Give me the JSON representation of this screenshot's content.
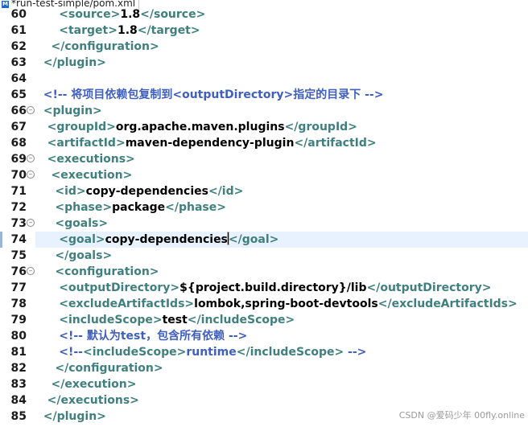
{
  "tab": {
    "title": "*run-test-simple/pom.xml",
    "icon": "xml-file-icon"
  },
  "lines": [
    {
      "num": "60",
      "fold": false,
      "segments": [
        {
          "t": "      ",
          "c": "tx"
        },
        {
          "t": "<source>",
          "c": "tg"
        },
        {
          "t": "1.8",
          "c": "tx"
        },
        {
          "t": "</source>",
          "c": "tg"
        }
      ]
    },
    {
      "num": "61",
      "fold": false,
      "segments": [
        {
          "t": "      ",
          "c": "tx"
        },
        {
          "t": "<target>",
          "c": "tg"
        },
        {
          "t": "1.8",
          "c": "tx"
        },
        {
          "t": "</target>",
          "c": "tg"
        }
      ]
    },
    {
      "num": "62",
      "fold": false,
      "segments": [
        {
          "t": "    ",
          "c": "tx"
        },
        {
          "t": "</configuration>",
          "c": "tg"
        }
      ]
    },
    {
      "num": "63",
      "fold": false,
      "segments": [
        {
          "t": "  ",
          "c": "tx"
        },
        {
          "t": "</plugin>",
          "c": "tg"
        }
      ]
    },
    {
      "num": "64",
      "fold": false,
      "segments": []
    },
    {
      "num": "65",
      "fold": false,
      "segments": [
        {
          "t": "  ",
          "c": "tx"
        },
        {
          "t": "<!-- 将项目依赖包复制到<outputDirectory>指定的目录下 -->",
          "c": "cm"
        }
      ]
    },
    {
      "num": "66",
      "fold": true,
      "segments": [
        {
          "t": "  ",
          "c": "tx"
        },
        {
          "t": "<plugin>",
          "c": "tg"
        }
      ]
    },
    {
      "num": "67",
      "fold": false,
      "segments": [
        {
          "t": "   ",
          "c": "tx"
        },
        {
          "t": "<groupId>",
          "c": "tg"
        },
        {
          "t": "org.apache.maven.plugins",
          "c": "tx"
        },
        {
          "t": "</groupId>",
          "c": "tg"
        }
      ]
    },
    {
      "num": "68",
      "fold": false,
      "segments": [
        {
          "t": "   ",
          "c": "tx"
        },
        {
          "t": "<artifactId>",
          "c": "tg"
        },
        {
          "t": "maven-dependency-plugin",
          "c": "tx"
        },
        {
          "t": "</artifactId>",
          "c": "tg"
        }
      ]
    },
    {
      "num": "69",
      "fold": true,
      "segments": [
        {
          "t": "   ",
          "c": "tx"
        },
        {
          "t": "<executions>",
          "c": "tg"
        }
      ]
    },
    {
      "num": "70",
      "fold": true,
      "segments": [
        {
          "t": "    ",
          "c": "tx"
        },
        {
          "t": "<execution>",
          "c": "tg"
        }
      ]
    },
    {
      "num": "71",
      "fold": false,
      "segments": [
        {
          "t": "     ",
          "c": "tx"
        },
        {
          "t": "<id>",
          "c": "tg"
        },
        {
          "t": "copy-dependencies",
          "c": "tx"
        },
        {
          "t": "</id>",
          "c": "tg"
        }
      ]
    },
    {
      "num": "72",
      "fold": false,
      "segments": [
        {
          "t": "     ",
          "c": "tx"
        },
        {
          "t": "<phase>",
          "c": "tg"
        },
        {
          "t": "package",
          "c": "tx"
        },
        {
          "t": "</phase>",
          "c": "tg"
        }
      ]
    },
    {
      "num": "73",
      "fold": true,
      "segments": [
        {
          "t": "     ",
          "c": "tx"
        },
        {
          "t": "<goals>",
          "c": "tg"
        }
      ]
    },
    {
      "num": "74",
      "fold": false,
      "current": true,
      "segments": [
        {
          "t": "      ",
          "c": "tx"
        },
        {
          "t": "<goal>",
          "c": "tg"
        },
        {
          "t": "copy-dependencies",
          "c": "tx"
        },
        {
          "t": "</goal>",
          "c": "tg"
        }
      ]
    },
    {
      "num": "75",
      "fold": false,
      "segments": [
        {
          "t": "     ",
          "c": "tx"
        },
        {
          "t": "</goals>",
          "c": "tg"
        }
      ]
    },
    {
      "num": "76",
      "fold": true,
      "segments": [
        {
          "t": "     ",
          "c": "tx"
        },
        {
          "t": "<configuration>",
          "c": "tg"
        }
      ]
    },
    {
      "num": "77",
      "fold": false,
      "segments": [
        {
          "t": "      ",
          "c": "tx"
        },
        {
          "t": "<outputDirectory>",
          "c": "tg"
        },
        {
          "t": "${project.build.directory}/lib",
          "c": "tx"
        },
        {
          "t": "</outputDirectory>",
          "c": "tg"
        }
      ]
    },
    {
      "num": "78",
      "fold": false,
      "segments": [
        {
          "t": "      ",
          "c": "tx"
        },
        {
          "t": "<excludeArtifactIds>",
          "c": "tg"
        },
        {
          "t": "lombok,spring-boot-devtools",
          "c": "tx"
        },
        {
          "t": "</excludeArtifactIds>",
          "c": "tg"
        }
      ]
    },
    {
      "num": "79",
      "fold": false,
      "segments": [
        {
          "t": "      ",
          "c": "tx"
        },
        {
          "t": "<includeScope>",
          "c": "tg"
        },
        {
          "t": "test",
          "c": "tx"
        },
        {
          "t": "</includeScope>",
          "c": "tg"
        }
      ]
    },
    {
      "num": "80",
      "fold": false,
      "segments": [
        {
          "t": "      ",
          "c": "tx"
        },
        {
          "t": "<!-- 默认为test，包含所有依赖 -->",
          "c": "cm"
        }
      ]
    },
    {
      "num": "81",
      "fold": false,
      "segments": [
        {
          "t": "      ",
          "c": "tx"
        },
        {
          "t": "<!--",
          "c": "cm"
        },
        {
          "t": "<includeScope>",
          "c": "tg"
        },
        {
          "t": "runtime",
          "c": "cm"
        },
        {
          "t": "</includeScope>",
          "c": "tg"
        },
        {
          "t": " -->",
          "c": "cm"
        }
      ]
    },
    {
      "num": "82",
      "fold": false,
      "segments": [
        {
          "t": "     ",
          "c": "tx"
        },
        {
          "t": "</configuration>",
          "c": "tg"
        }
      ]
    },
    {
      "num": "83",
      "fold": false,
      "segments": [
        {
          "t": "    ",
          "c": "tx"
        },
        {
          "t": "</execution>",
          "c": "tg"
        }
      ]
    },
    {
      "num": "84",
      "fold": false,
      "segments": [
        {
          "t": "   ",
          "c": "tx"
        },
        {
          "t": "</executions>",
          "c": "tg"
        }
      ]
    },
    {
      "num": "85",
      "fold": false,
      "segments": [
        {
          "t": "  ",
          "c": "tx"
        },
        {
          "t": "</plugin>",
          "c": "tg"
        }
      ]
    }
  ],
  "colors": {
    "tag": "#3f7f7f",
    "text": "#000000",
    "comment": "#3f5fbf",
    "current_line": "#e8f2fe"
  },
  "watermark": "CSDN @爱码少年 00fly.online"
}
